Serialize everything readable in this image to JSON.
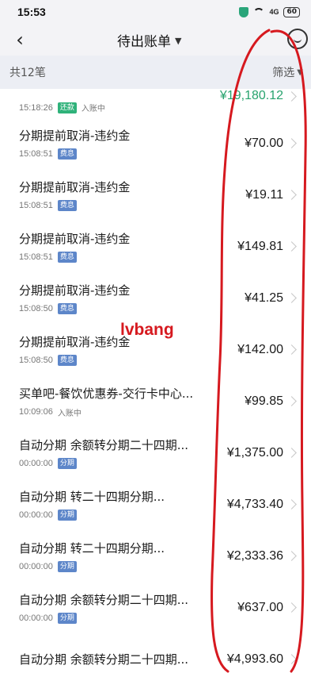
{
  "status_bar": {
    "time": "15:53",
    "signal": "4G",
    "battery": "60"
  },
  "nav": {
    "title": "待出账单"
  },
  "summary": {
    "count": "共12笔",
    "filter": "筛选"
  },
  "transactions": [
    {
      "title": "",
      "time": "15:18:26",
      "tag": "还款",
      "status": "入账中",
      "amount": "¥19,180.12"
    },
    {
      "title": "分期提前取消-违约金",
      "time": "15:08:51",
      "tag": "费息",
      "status": "",
      "amount": "¥70.00"
    },
    {
      "title": "分期提前取消-违约金",
      "time": "15:08:51",
      "tag": "费息",
      "status": "",
      "amount": "¥19.11"
    },
    {
      "title": "分期提前取消-违约金",
      "time": "15:08:51",
      "tag": "费息",
      "status": "",
      "amount": "¥149.81"
    },
    {
      "title": "分期提前取消-违约金",
      "time": "15:08:50",
      "tag": "费息",
      "status": "",
      "amount": "¥41.25"
    },
    {
      "title": "分期提前取消-违约金",
      "time": "15:08:50",
      "tag": "费息",
      "status": "",
      "amount": "¥142.00"
    },
    {
      "title": "买单吧-餐饮优惠券-交行卡中心...",
      "time": "10:09:06",
      "tag": "",
      "status": "入账中",
      "amount": "¥99.85"
    },
    {
      "title": "自动分期 余额转分期二十四期...",
      "time": "00:00:00",
      "tag": "分期",
      "status": "",
      "amount": "¥1,375.00"
    },
    {
      "title": "自动分期 转二十四期分期...",
      "time": "00:00:00",
      "tag": "分期",
      "status": "",
      "amount": "¥4,733.40"
    },
    {
      "title": "自动分期 转二十四期分期...",
      "time": "00:00:00",
      "tag": "分期",
      "status": "",
      "amount": "¥2,333.36"
    },
    {
      "title": "自动分期 余额转分期二十四期...",
      "time": "00:00:00",
      "tag": "分期",
      "status": "",
      "amount": "¥637.00"
    },
    {
      "title": "自动分期 余额转分期二十四期...",
      "time": "",
      "tag": "",
      "status": "",
      "amount": "¥4,993.60"
    }
  ],
  "watermark": "lvbang",
  "colors": {
    "tag_green": "#2fb27a",
    "tag_blue": "#5d86c9",
    "amount_green": "#28a36e",
    "annotation_red": "#d6191f"
  }
}
